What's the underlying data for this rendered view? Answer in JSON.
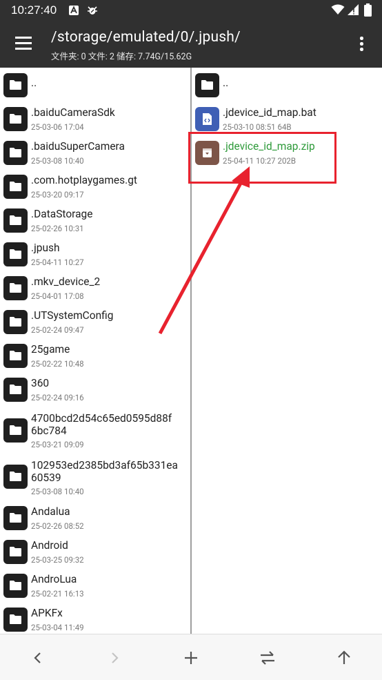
{
  "status_bar": {
    "time": "10:27:40",
    "icons": [
      "a-notification-icon",
      "bug-notification-icon",
      "wifi-icon",
      "signal-icon",
      "battery-icon"
    ]
  },
  "toolbar": {
    "menu_icon": "hamburger-menu-icon",
    "path": "/storage/emulated/0/.jpush/",
    "subtitle": "文件夹: 0  文件: 2  储存: 7.74G/15.62G",
    "more_icon": "more-vert-icon"
  },
  "left_pane": {
    "items": [
      {
        "name": "..",
        "meta": "",
        "type": "folder"
      },
      {
        "name": ".baiduCameraSdk",
        "meta": "25-03-06 17:04",
        "type": "folder"
      },
      {
        "name": ".baiduSuperCamera",
        "meta": "25-03-08 10:40",
        "type": "folder"
      },
      {
        "name": ".com.hotplaygames.gt",
        "meta": "25-03-20 09:17",
        "type": "folder"
      },
      {
        "name": ".DataStorage",
        "meta": "25-02-26 10:31",
        "type": "folder"
      },
      {
        "name": ".jpush",
        "meta": "25-04-11 10:27",
        "type": "folder"
      },
      {
        "name": ".mkv_device_2",
        "meta": "25-04-01 17:08",
        "type": "folder"
      },
      {
        "name": ".UTSystemConfig",
        "meta": "25-02-24 09:47",
        "type": "folder"
      },
      {
        "name": "25game",
        "meta": "25-02-22 10:48",
        "type": "folder"
      },
      {
        "name": "360",
        "meta": "25-02-24 09:16",
        "type": "folder"
      },
      {
        "name": "4700bcd2d54c65ed0595d88f",
        "name2": "6bc784",
        "meta": "25-03-21 09:09",
        "type": "folder"
      },
      {
        "name": "102953ed2385bd3af65b331ea",
        "name2": "60539",
        "meta": "25-03-08 10:40",
        "type": "folder"
      },
      {
        "name": "Andalua",
        "meta": "25-02-26 08:52",
        "type": "folder"
      },
      {
        "name": "Android",
        "meta": "25-03-25 09:32",
        "type": "folder"
      },
      {
        "name": "AndroLua",
        "meta": "25-02-21 16:13",
        "type": "folder"
      },
      {
        "name": "APKFx",
        "meta": "25-03-04 11:49",
        "type": "folder"
      }
    ]
  },
  "right_pane": {
    "items": [
      {
        "name": "..",
        "meta": "",
        "type": "folder"
      },
      {
        "name": ".jdevice_id_map.bat",
        "meta": "25-03-10 08:51  64B",
        "type": "code-file"
      },
      {
        "name": ".jdevice_id_map.zip",
        "meta": "25-04-11 10:27  202B",
        "type": "archive-file",
        "highlight": true
      }
    ]
  },
  "bottom_bar": {
    "buttons": [
      "back-arrow-icon",
      "forward-arrow-icon",
      "add-icon",
      "swap-panes-icon",
      "up-arrow-icon"
    ]
  },
  "colors": {
    "toolbar_bg": "#303030",
    "folder_icon_bg": "#1f1f1f",
    "bat_icon_bg": "#3f5fb5",
    "zip_icon_bg": "#7d5548",
    "highlight_text": "#2e9a3a",
    "annotation_red": "#e8222e"
  }
}
